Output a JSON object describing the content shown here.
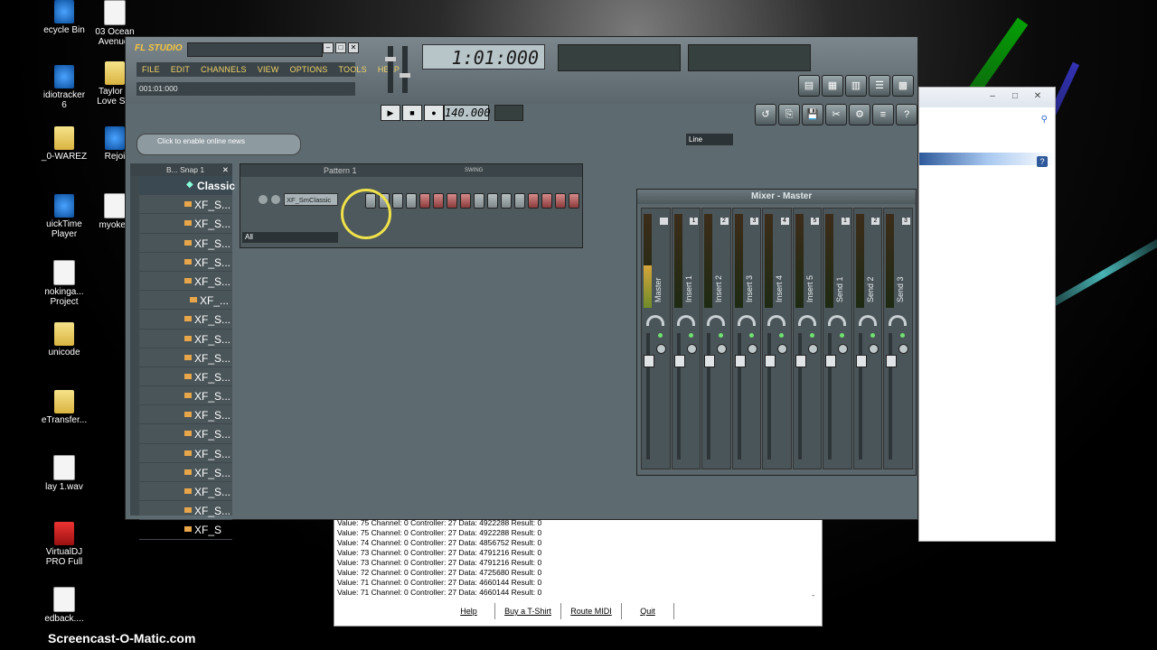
{
  "desktop": {
    "icons_left": [
      {
        "label": "ecycle Bin",
        "icon": "recycle-bin-icon"
      },
      {
        "label": "idiotracker\n6",
        "icon": "app-icon"
      },
      {
        "label": "_0-WAREZ",
        "icon": "folder-icon"
      },
      {
        "label": "uickTime\nPlayer",
        "icon": "quicktime-icon"
      },
      {
        "label": "nokinga...\nProject",
        "icon": "project-icon"
      },
      {
        "label": "unicode",
        "icon": "folder-icon"
      },
      {
        "label": "eTransfer...",
        "icon": "folder-icon"
      },
      {
        "label": "lay 1.wav",
        "icon": "wav-file-icon"
      },
      {
        "label": "VirtualDJ\nPRO Full",
        "icon": "virtualdj-icon"
      },
      {
        "label": "edback....",
        "icon": "wav-file-icon"
      }
    ],
    "icons_col2": [
      {
        "label": "03 Ocean\nAvenue.",
        "icon": "audio-file-icon"
      },
      {
        "label": "Taylor S\nLove Sto",
        "icon": "folder-icon"
      },
      {
        "label": "Rejoi",
        "icon": "app-icon"
      },
      {
        "label": "myoken",
        "icon": "file-icon"
      }
    ]
  },
  "fl_studio": {
    "logo": "FL STUDIO",
    "menu": [
      "FILE",
      "EDIT",
      "CHANNELS",
      "VIEW",
      "OPTIONS",
      "TOOLS",
      "HELP"
    ],
    "hint": "001:01:000",
    "time_display": "1:01:000",
    "tempo": "140.000",
    "news_text": "Click to enable online news",
    "line_select": "Line",
    "browser": {
      "header": "B... Snap 1",
      "items": [
        "Classic",
        "XF_S...",
        "XF_S...",
        "XF_S...",
        "XF_S...",
        "XF_S...",
        "XF_...",
        "XF_S...",
        "XF_S...",
        "XF_S...",
        "XF_S...",
        "XF_S...",
        "XF_S...",
        "XF_S...",
        "XF_S...",
        "XF_S...",
        "XF_S...",
        "XF_S...",
        "XF_S"
      ]
    },
    "pattern": {
      "title": "Pattern 1",
      "swing_label": "SWING",
      "channel_name": "XF_SmClassic",
      "filter": "All"
    },
    "mixer": {
      "title": "Mixer - Master",
      "strips": [
        {
          "name": "Master",
          "num": ""
        },
        {
          "name": "Insert 1",
          "num": "1"
        },
        {
          "name": "Insert 2",
          "num": "2"
        },
        {
          "name": "Insert 3",
          "num": "3"
        },
        {
          "name": "Insert 4",
          "num": "4"
        },
        {
          "name": "Insert 5",
          "num": "5"
        },
        {
          "name": "Send 1",
          "num": "1"
        },
        {
          "name": "Send 2",
          "num": "2"
        },
        {
          "name": "Send 3",
          "num": "3"
        }
      ]
    }
  },
  "midi_log": {
    "lines": [
      "Value: 75 Channel: 0 Controller: 27  Data: 4922288 Result: 0",
      "Value: 75 Channel: 0 Controller: 27  Data: 4922288 Result: 0",
      "Value: 74 Channel: 0 Controller: 27  Data: 4856752 Result: 0",
      "Value: 73 Channel: 0 Controller: 27  Data: 4791216 Result: 0",
      "Value: 73 Channel: 0 Controller: 27  Data: 4791216 Result: 0",
      "Value: 72 Channel: 0 Controller: 27  Data: 4725680 Result: 0",
      "Value: 71 Channel: 0 Controller: 27  Data: 4660144 Result: 0",
      "Value: 71 Channel: 0 Controller: 27  Data: 4660144 Result: 0"
    ],
    "buttons": [
      "Help",
      "Buy a T-Shirt",
      "Route MIDI",
      "Quit"
    ]
  },
  "watermark": "Screencast-O-Matic.com"
}
